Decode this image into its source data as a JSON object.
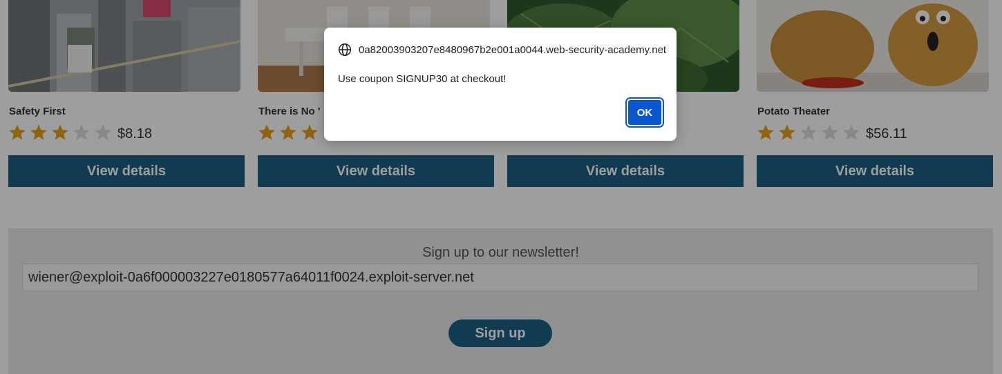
{
  "products": [
    {
      "title": "Safety First",
      "rating": 3,
      "price": "$8.18",
      "button": "View details"
    },
    {
      "title": "There is No '",
      "rating": 3,
      "price": "",
      "button": "View details"
    },
    {
      "title": "",
      "rating": 0,
      "price": "",
      "button": "View details"
    },
    {
      "title": "Potato Theater",
      "rating": 2,
      "price": "$56.11",
      "button": "View details"
    }
  ],
  "newsletter": {
    "title": "Sign up to our newsletter!",
    "email_value": "wiener@exploit-0a6f000003227e0180577a64011f0024.exploit-server.net",
    "button": "Sign up"
  },
  "dialog": {
    "origin": "0a82003903207e8480967b2e001a0044.web-security-academy.net",
    "message": "Use coupon SIGNUP30 at checkout!",
    "ok_label": "OK"
  },
  "colors": {
    "primary": "#1c5f84",
    "star_filled": "#e8a11c",
    "star_empty": "#d9dde2",
    "dialog_button": "#0b57d0",
    "overlay": "rgba(0,0,0,0.38)"
  }
}
